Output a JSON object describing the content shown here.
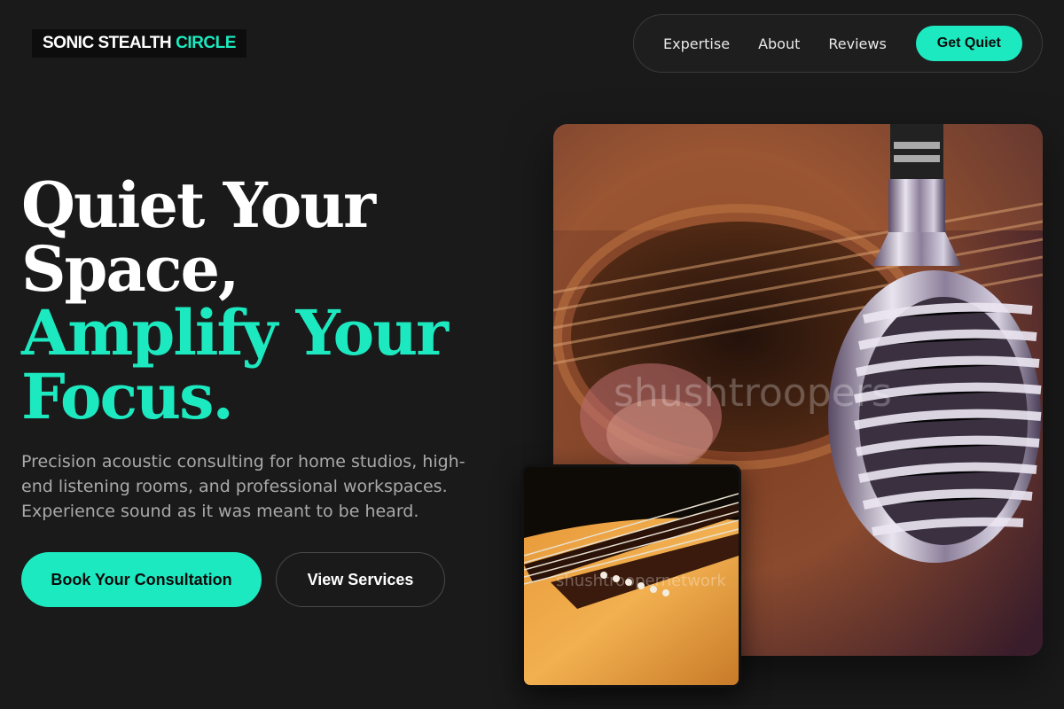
{
  "brand": {
    "name_part1": "SONIC STEALTH",
    "name_part2": "CIRCLE"
  },
  "nav": {
    "items": [
      {
        "label": "Expertise"
      },
      {
        "label": "About"
      },
      {
        "label": "Reviews"
      }
    ],
    "cta_label": "Get Quiet"
  },
  "hero": {
    "headline_line1": "Quiet Your",
    "headline_line2": "Space,",
    "headline_line3": "Amplify Your",
    "headline_line4": "Focus.",
    "description": "Precision acoustic consulting for home studios, high-end listening rooms, and professional workspaces. Experience sound as it was meant to be heard.",
    "primary_button": "Book Your Consultation",
    "secondary_button": "View Services"
  },
  "images": {
    "main_watermark": "shushtroopers",
    "small_watermark": "shushtroopernetwork"
  },
  "colors": {
    "accent": "#1de9c0",
    "background": "#1a1a1a"
  }
}
